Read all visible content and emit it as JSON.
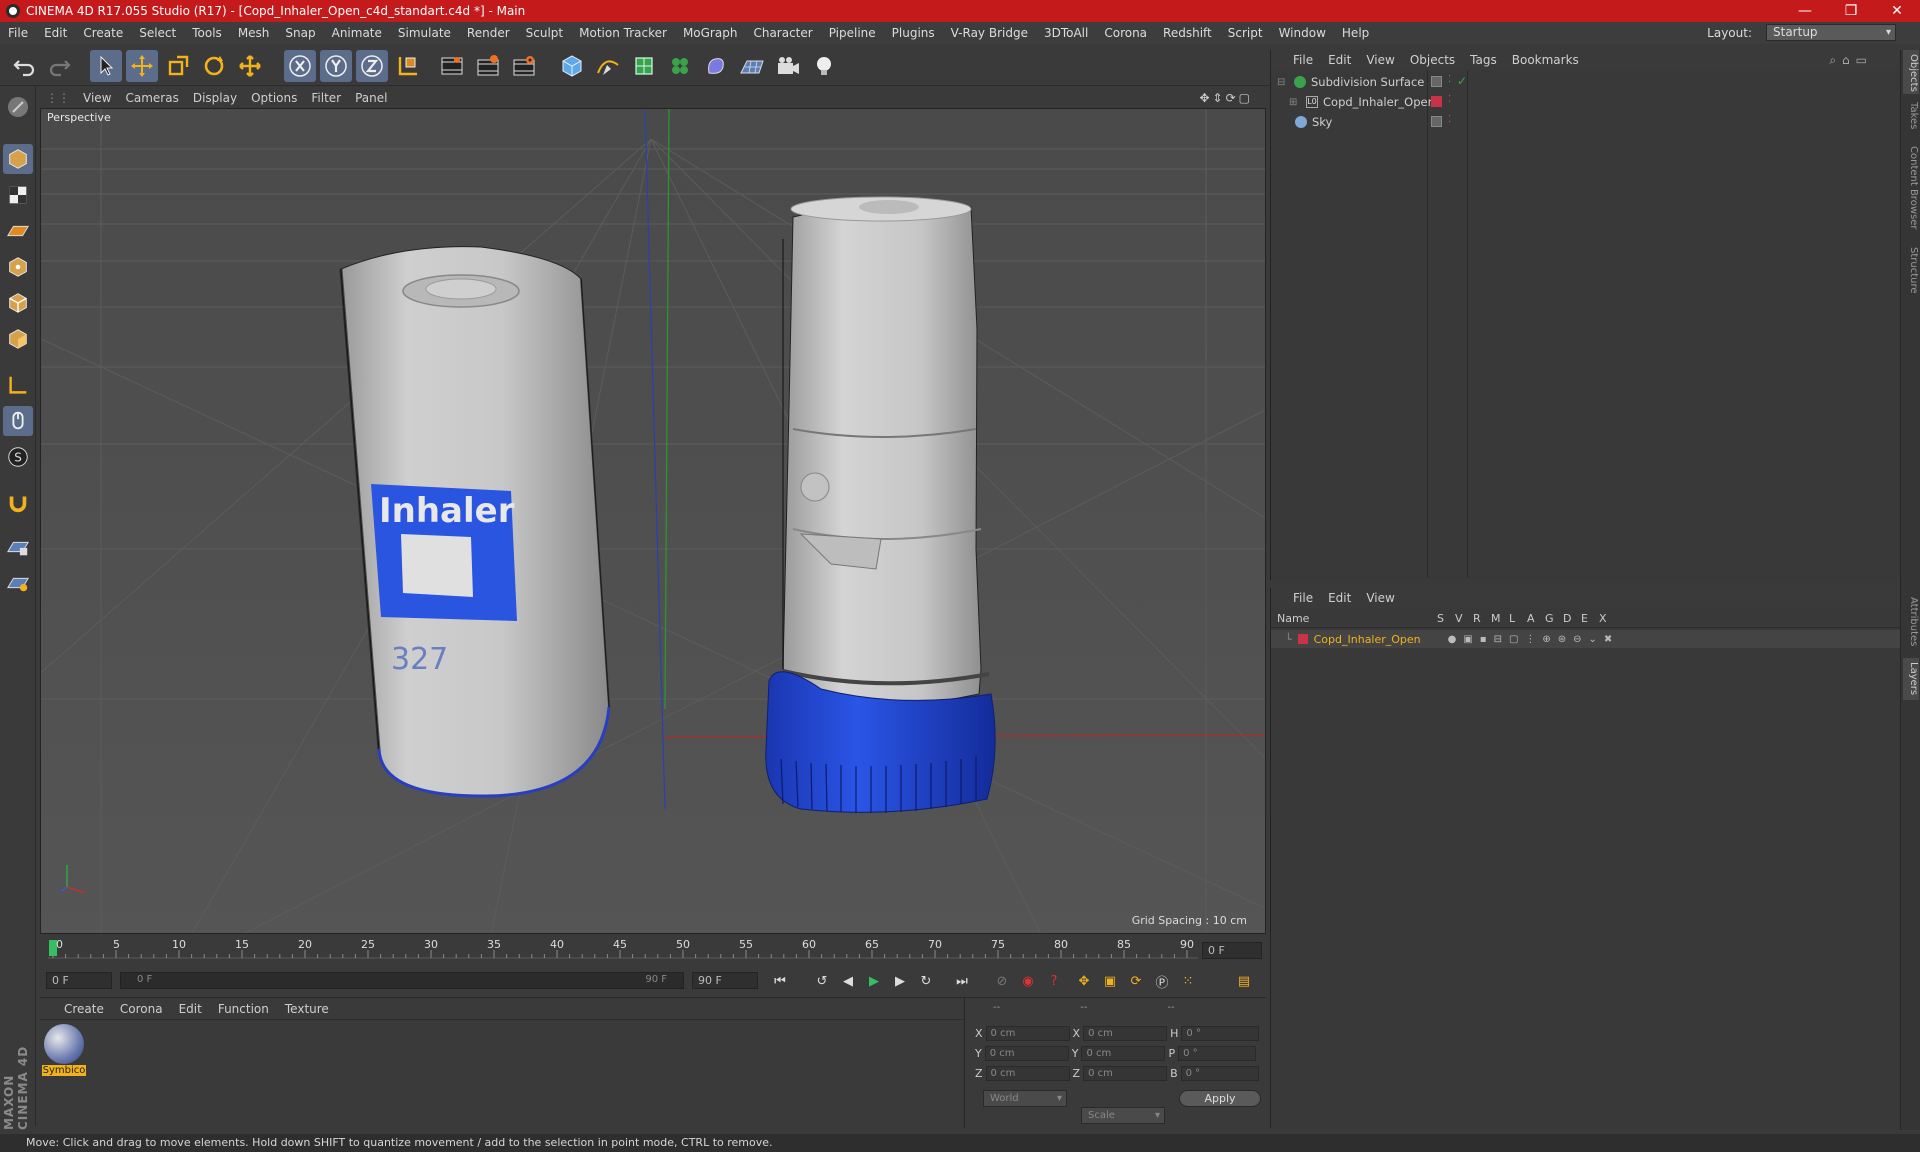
{
  "window": {
    "title": "CINEMA 4D R17.055 Studio (R17) - [Copd_Inhaler_Open_c4d_standart.c4d *] - Main",
    "controls": [
      "—",
      "❐",
      "✕"
    ]
  },
  "menubar": {
    "items": [
      "File",
      "Edit",
      "Create",
      "Select",
      "Tools",
      "Mesh",
      "Snap",
      "Animate",
      "Simulate",
      "Render",
      "Sculpt",
      "Motion Tracker",
      "MoGraph",
      "Character",
      "Pipeline",
      "Plugins",
      "V-Ray Bridge",
      "3DToAll",
      "Corona",
      "Redshift",
      "Script",
      "Window",
      "Help"
    ],
    "layout_label": "Layout:",
    "layout_value": "Startup"
  },
  "toolbar": {
    "icons": [
      "undo-icon",
      "redo-icon",
      "select-arrow-icon",
      "move-icon",
      "scale-icon",
      "rotate-icon",
      "live-selection-icon",
      "x-axis-icon",
      "y-axis-icon",
      "z-axis-icon",
      "world-coords-icon",
      "render-view-icon",
      "render-picture-icon",
      "render-settings-icon",
      "cube-icon",
      "pen-spline-icon",
      "subdivision-icon",
      "mograph-cloner-icon",
      "deformer-icon",
      "floor-icon",
      "camera-icon",
      "light-icon"
    ]
  },
  "viewport": {
    "menu": [
      "View",
      "Cameras",
      "Display",
      "Options",
      "Filter",
      "Panel"
    ],
    "label": "Perspective",
    "grid_spacing": "Grid Spacing : 10 cm",
    "left_object_text": "Inhaler",
    "left_object_number": "327"
  },
  "timeline": {
    "ticks": [
      "0",
      "5",
      "10",
      "15",
      "20",
      "25",
      "30",
      "35",
      "40",
      "45",
      "50",
      "55",
      "60",
      "65",
      "70",
      "75",
      "80",
      "85",
      "90"
    ],
    "end_frame_field": "0 F"
  },
  "transport": {
    "start_field": "0 F",
    "range_start": "0 F",
    "range_end": "90 F",
    "end_field": "90 F"
  },
  "material_manager": {
    "menu": [
      "Create",
      "Corona",
      "Edit",
      "Function",
      "Texture"
    ],
    "material_name": "Symbico"
  },
  "coordinates": {
    "headers": [
      "--",
      "--",
      "--"
    ],
    "rows": [
      {
        "a": "X",
        "v1": "0 cm",
        "b": "X",
        "v2": "0 cm",
        "c": "H",
        "v3": "0 °"
      },
      {
        "a": "Y",
        "v1": "0 cm",
        "b": "Y",
        "v2": "0 cm",
        "c": "P",
        "v3": "0 °"
      },
      {
        "a": "Z",
        "v1": "0 cm",
        "b": "Z",
        "v2": "0 cm",
        "c": "B",
        "v3": "0 °"
      }
    ],
    "mode1": "World",
    "mode2": "Scale",
    "apply": "Apply"
  },
  "object_manager": {
    "menu": [
      "File",
      "Edit",
      "View",
      "Objects",
      "Tags",
      "Bookmarks"
    ],
    "objects": [
      {
        "name": "Subdivision Surface"
      },
      {
        "name": "Copd_Inhaler_Open"
      },
      {
        "name": "Sky"
      }
    ]
  },
  "layer_manager": {
    "menu": [
      "File",
      "Edit",
      "View"
    ],
    "columns": [
      "Name",
      "S",
      "V",
      "R",
      "M",
      "L",
      "A",
      "G",
      "D",
      "E",
      "X"
    ],
    "layers": [
      {
        "name": "Copd_Inhaler_Open",
        "color": "#c8334a"
      }
    ]
  },
  "side_tabs": [
    "Objects",
    "Takes",
    "Content Browser",
    "Structure"
  ],
  "side_tabs_lower": [
    "Attributes",
    "Layers"
  ],
  "branding": "MAXON CINEMA 4D",
  "status": "Move: Click and drag to move elements. Hold down SHIFT to quantize movement / add to the selection in point mode, CTRL to remove.",
  "colors": {
    "title_bar": "#c41a1c",
    "accent": "#5b6d8a",
    "layer_color": "#c8334a",
    "inhaler_blue": "#2248d6"
  }
}
